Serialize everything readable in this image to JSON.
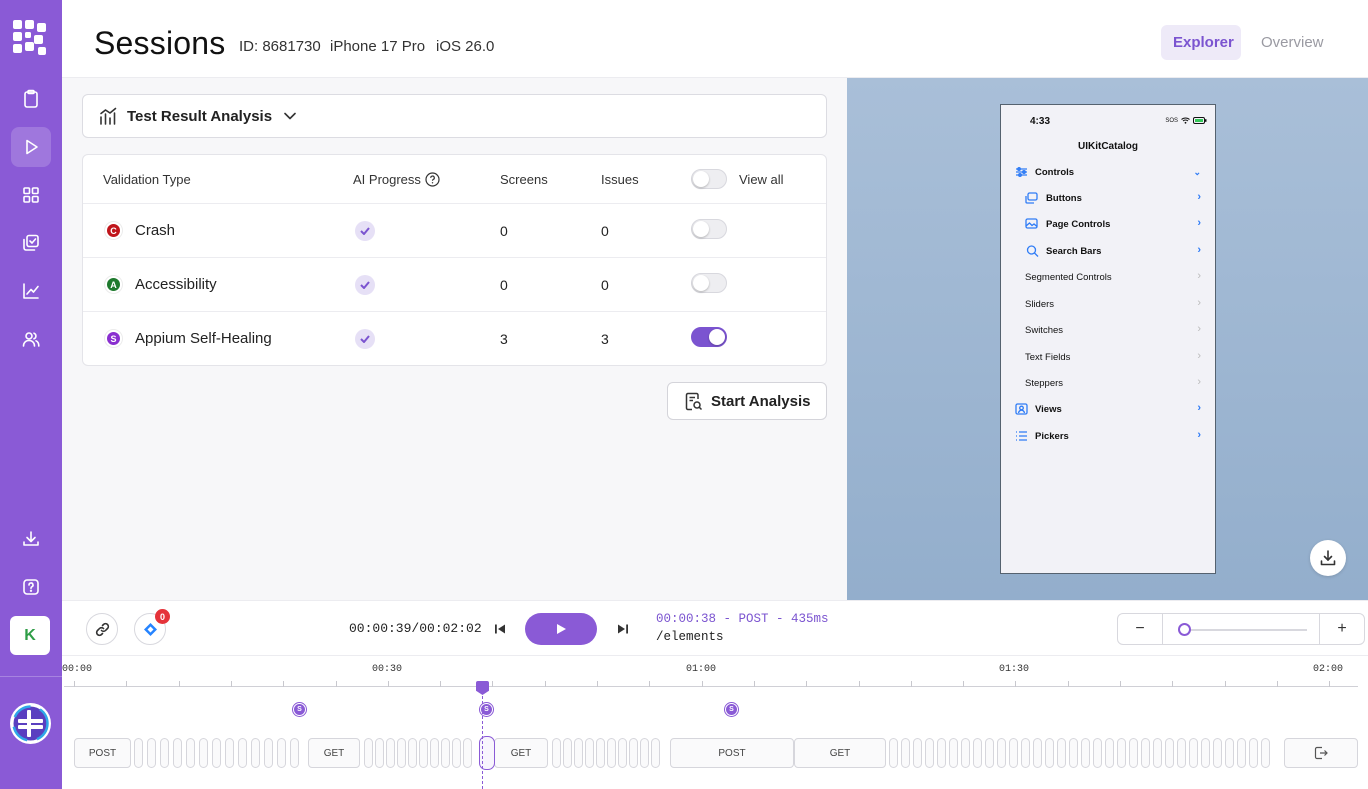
{
  "header": {
    "title": "Sessions",
    "session_id": "ID: 8681730",
    "device": "iPhone 17 Pro",
    "os": "iOS 26.0",
    "tabs": [
      {
        "label": "Explorer",
        "active": true
      },
      {
        "label": "Overview",
        "active": false
      }
    ]
  },
  "sidebar": {
    "avatar_initial": "K",
    "items": [
      "clipboard-icon",
      "play-icon",
      "grid-icon",
      "copy-check-icon",
      "chart-icon",
      "users-icon",
      "download-icon",
      "help-icon"
    ],
    "active_item": "play-icon"
  },
  "analysis": {
    "dropdown_label": "Test Result Analysis",
    "columns": {
      "validation_type": "Validation Type",
      "ai_progress": "AI Progress",
      "screens": "Screens",
      "issues": "Issues",
      "view_all": "View all"
    },
    "view_all_on": false,
    "rows": [
      {
        "badge": "C",
        "badge_color": "#c0151b",
        "name": "Crash",
        "screens": "0",
        "issues": "0",
        "toggle_on": false
      },
      {
        "badge": "A",
        "badge_color": "#1f7a2e",
        "name": "Accessibility",
        "screens": "0",
        "issues": "0",
        "toggle_on": false
      },
      {
        "badge": "S",
        "badge_color": "#8a2fd0",
        "name": "Appium Self-Healing",
        "screens": "3",
        "issues": "3",
        "toggle_on": true
      }
    ],
    "start_button": "Start Analysis"
  },
  "device_screen": {
    "time": "4:33",
    "status_text": "SOS",
    "app_title": "UIKitCatalog",
    "items": [
      {
        "label": "Controls",
        "icon": "sliders-icon",
        "bold": true,
        "expanded": true
      },
      {
        "label": "Buttons",
        "icon": "buttons-icon",
        "bold": true
      },
      {
        "label": "Page Controls",
        "icon": "image-icon",
        "bold": true
      },
      {
        "label": "Search Bars",
        "icon": "search-icon",
        "bold": true
      },
      {
        "label": "Segmented Controls",
        "bold": false
      },
      {
        "label": "Sliders",
        "bold": false
      },
      {
        "label": "Switches",
        "bold": false
      },
      {
        "label": "Text Fields",
        "bold": false
      },
      {
        "label": "Steppers",
        "bold": false
      },
      {
        "label": "Views",
        "icon": "person-icon",
        "bold": true
      },
      {
        "label": "Pickers",
        "icon": "list-icon",
        "bold": true
      }
    ]
  },
  "player": {
    "jira_count": "0",
    "time_display": "00:00:39/00:02:02",
    "request_line1": "00:00:38 - POST - 435ms",
    "request_line2": "/elements",
    "zoom_level": 0.0
  },
  "timeline": {
    "labels": [
      "00:00",
      "00:30",
      "01:00",
      "01:30",
      "02:00"
    ],
    "markers": [
      "S",
      "S",
      "S"
    ],
    "requests": [
      "POST",
      "GET",
      "GET",
      "POST",
      "GET"
    ],
    "playhead_time": "00:00:39"
  },
  "colors": {
    "brand": "#8a5ad6",
    "accent_text": "#7b54d0"
  }
}
